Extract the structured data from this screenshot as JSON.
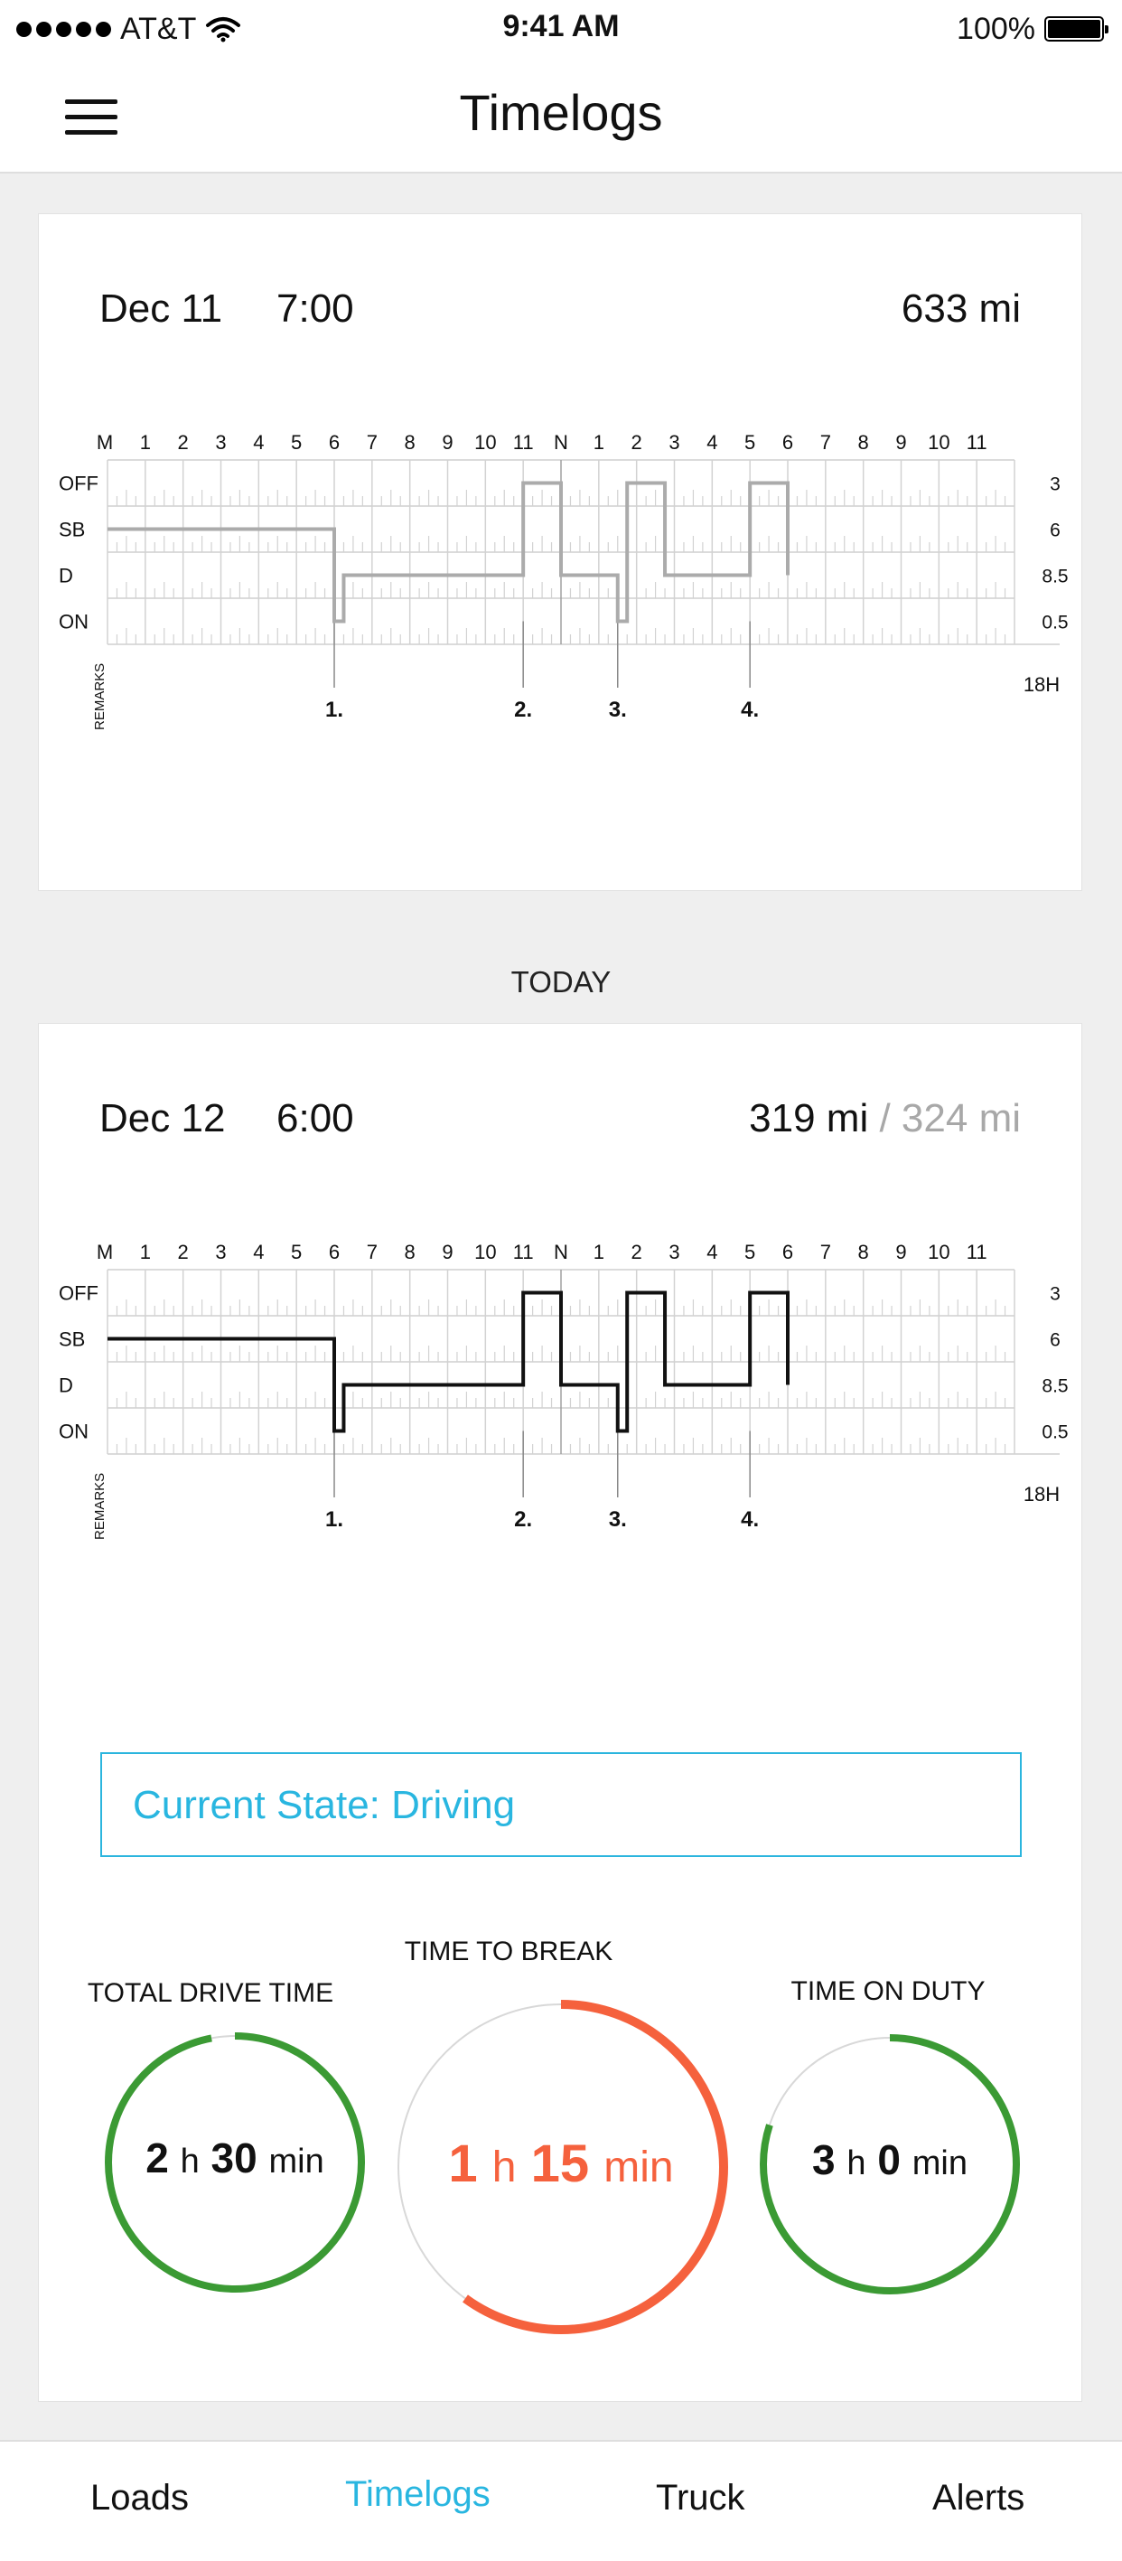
{
  "status_bar": {
    "carrier": "AT&T",
    "time": "9:41 AM",
    "battery": "100%"
  },
  "header": {
    "title": "Timelogs",
    "menu_icon": "hamburger-icon"
  },
  "chart_axis": {
    "top_labels": [
      "M",
      "1",
      "2",
      "3",
      "4",
      "5",
      "6",
      "7",
      "8",
      "9",
      "10",
      "11",
      "N",
      "1",
      "2",
      "3",
      "4",
      "5",
      "6",
      "7",
      "8",
      "9",
      "10",
      "11"
    ],
    "row_labels": [
      "OFF",
      "SB",
      "D",
      "ON"
    ],
    "remarks_label": "REMARKS",
    "total_label": "18H"
  },
  "logs": [
    {
      "date": "Dec 11",
      "time": "7:00",
      "miles": "633 mi",
      "row_totals": [
        "3",
        "6",
        "8.5",
        "0.5"
      ],
      "remarks": [
        "1.",
        "2.",
        "3.",
        "4."
      ],
      "color": "#ababab"
    },
    {
      "date": "Dec 12",
      "time": "6:00",
      "miles": "319 mi",
      "miles_total": "/ 324 mi",
      "row_totals": [
        "3",
        "6",
        "8.5",
        "0.5"
      ],
      "remarks": [
        "1.",
        "2.",
        "3.",
        "4."
      ],
      "color": "#111111"
    }
  ],
  "today_label": "TODAY",
  "current_state": "Current State: Driving",
  "gauges": {
    "drive": {
      "label": "TOTAL DRIVE TIME",
      "hours": "2",
      "h": "h",
      "minutes": "30",
      "min": "min",
      "progress": 0.97,
      "color": "#3b9a34"
    },
    "break": {
      "label": "TIME TO BREAK",
      "hours": "1",
      "h": "h",
      "minutes": "15",
      "min": "min",
      "progress": 0.6,
      "color": "#f5613d"
    },
    "duty": {
      "label": "TIME ON DUTY",
      "hours": "3",
      "h": "h",
      "minutes": "0",
      "min": "min",
      "progress": 0.8,
      "color": "#3b9a34"
    }
  },
  "tabs": [
    {
      "label": "Loads",
      "active": false
    },
    {
      "label": "Timelogs",
      "active": true
    },
    {
      "label": "Truck",
      "active": false
    },
    {
      "label": "Alerts",
      "active": false
    }
  ],
  "colors": {
    "accent": "#29b6e0",
    "green": "#3b9a34",
    "orange": "#f5613d"
  }
}
